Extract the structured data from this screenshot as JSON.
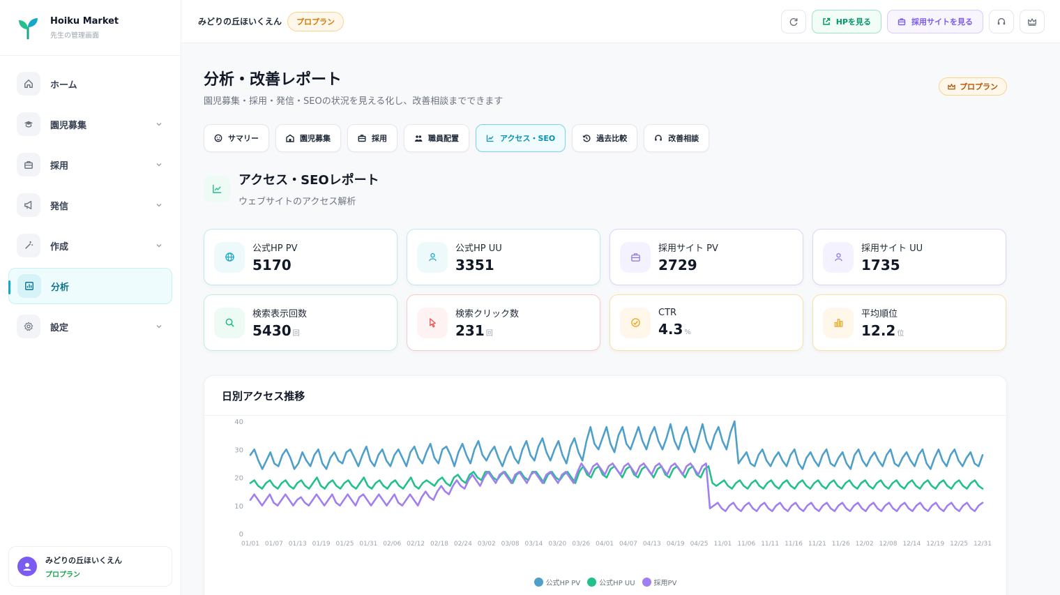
{
  "brand": {
    "name": "Hoiku Market",
    "subtitle": "先生の管理画面"
  },
  "sidebar": {
    "items": [
      {
        "label": "ホーム",
        "icon": "home-icon",
        "expandable": false
      },
      {
        "label": "園児募集",
        "icon": "graduation-cap-icon",
        "expandable": true
      },
      {
        "label": "採用",
        "icon": "briefcase-icon",
        "expandable": true
      },
      {
        "label": "発信",
        "icon": "megaphone-icon",
        "expandable": true
      },
      {
        "label": "作成",
        "icon": "wand-icon",
        "expandable": true
      },
      {
        "label": "分析",
        "icon": "chart-icon",
        "expandable": false,
        "active": true
      },
      {
        "label": "設定",
        "icon": "gear-icon",
        "expandable": true
      }
    ],
    "user": {
      "name": "みどりの丘ほいくえん",
      "plan": "プロプラン"
    }
  },
  "topbar": {
    "nursery": "みどりの丘ほいくえん",
    "plan": "プロプラン",
    "hp_button": "HPを見る",
    "recruit_button": "採用サイトを見る"
  },
  "page": {
    "title": "分析・改善レポート",
    "subtitle": "園児募集・採用・発信・SEOの状況を見える化し、改善相談までできます",
    "badge": "プロプラン"
  },
  "tabs": [
    {
      "label": "サマリー",
      "icon": "smile-icon"
    },
    {
      "label": "園児募集",
      "icon": "school-icon"
    },
    {
      "label": "採用",
      "icon": "briefcase-icon"
    },
    {
      "label": "職員配置",
      "icon": "people-icon"
    },
    {
      "label": "アクセス・SEO",
      "icon": "trend-icon",
      "active": true
    },
    {
      "label": "過去比較",
      "icon": "history-icon"
    },
    {
      "label": "改善相談",
      "icon": "headset-icon"
    }
  ],
  "section": {
    "title": "アクセス・SEOレポート",
    "subtitle": "ウェブサイトのアクセス解析"
  },
  "metrics": [
    {
      "label": "公式HP PV",
      "value": "5170",
      "unit": "",
      "icon": "globe-icon",
      "color": "#0ea5c6",
      "bg": "#eef9fc",
      "border": "#bfe9f2"
    },
    {
      "label": "公式HP UU",
      "value": "3351",
      "unit": "",
      "icon": "user-icon",
      "color": "#0ea5c6",
      "bg": "#eef9fc",
      "border": "#bfe9f2"
    },
    {
      "label": "採用サイト PV",
      "value": "2729",
      "unit": "",
      "icon": "briefcase-icon",
      "color": "#8b6cf0",
      "bg": "#f5f2ff",
      "border": "#ddd3fb"
    },
    {
      "label": "採用サイト UU",
      "value": "1735",
      "unit": "",
      "icon": "user-icon",
      "color": "#8b6cf0",
      "bg": "#f5f2ff",
      "border": "#ddd3fb"
    },
    {
      "label": "検索表示回数",
      "value": "5430",
      "unit": "回",
      "icon": "search-icon",
      "color": "#10b981",
      "bg": "#eefaf4",
      "border": "#bfeedd"
    },
    {
      "label": "検索クリック数",
      "value": "231",
      "unit": "回",
      "icon": "pointer-icon",
      "color": "#ef4444",
      "bg": "#fef2f2",
      "border": "#f9c9c9"
    },
    {
      "label": "CTR",
      "value": "4.3",
      "unit": "%",
      "icon": "target-icon",
      "color": "#f59e0b",
      "bg": "#fff8ea",
      "border": "#f9e2a6"
    },
    {
      "label": "平均順位",
      "value": "12.2",
      "unit": "位",
      "icon": "bar-icon",
      "color": "#f59e0b",
      "bg": "#fff8ea",
      "border": "#f9e2a6"
    }
  ],
  "chart_title": "日別アクセス推移",
  "chart_data": {
    "type": "line",
    "ylim": [
      0,
      40
    ],
    "yticks": [
      0,
      10,
      20,
      30,
      40
    ],
    "xticks": [
      "01/01",
      "01/07",
      "01/13",
      "01/19",
      "01/25",
      "01/31",
      "02/06",
      "02/12",
      "02/18",
      "02/24",
      "03/02",
      "03/08",
      "03/14",
      "03/20",
      "03/26",
      "04/01",
      "04/07",
      "04/13",
      "04/19",
      "04/25",
      "11/01",
      "11/06",
      "11/11",
      "11/16",
      "11/21",
      "11/26",
      "12/02",
      "12/08",
      "12/14",
      "12/19",
      "12/25",
      "12/31"
    ],
    "series": [
      {
        "name": "公式HP PV",
        "color": "#4e9fc9",
        "values": [
          28,
          30,
          26,
          23,
          26,
          29,
          25,
          24,
          28,
          30,
          27,
          23,
          25,
          29,
          26,
          24,
          28,
          30,
          25,
          23,
          27,
          29,
          26,
          25,
          29,
          30,
          27,
          24,
          28,
          31,
          26,
          24,
          28,
          30,
          26,
          24,
          28,
          30,
          27,
          24,
          29,
          31,
          27,
          25,
          29,
          32,
          27,
          25,
          30,
          31,
          28,
          24,
          29,
          32,
          28,
          25,
          30,
          33,
          28,
          26,
          29,
          31,
          27,
          24,
          28,
          31,
          27,
          25,
          30,
          33,
          28,
          26,
          31,
          34,
          29,
          26,
          30,
          33,
          28,
          25,
          31,
          34,
          29,
          26,
          33,
          38,
          32,
          30,
          34,
          38,
          32,
          29,
          35,
          38,
          32,
          30,
          34,
          38,
          33,
          30,
          35,
          38,
          33,
          30,
          34,
          39,
          33,
          30,
          35,
          38,
          32,
          29,
          34,
          39,
          33,
          30,
          35,
          38,
          33,
          30,
          36,
          40,
          25,
          27,
          29,
          25,
          24,
          28,
          30,
          26,
          24,
          27,
          29,
          26,
          24,
          28,
          30,
          25,
          23,
          27,
          29,
          26,
          24,
          28,
          30,
          25,
          24,
          27,
          29,
          25,
          23,
          28,
          30,
          26,
          24,
          27,
          29,
          26,
          24,
          28,
          30,
          25,
          24,
          27,
          29,
          26,
          24,
          28,
          30,
          25,
          23,
          27,
          30,
          26,
          24,
          28,
          30,
          26,
          24,
          27,
          29,
          25,
          24,
          28
        ]
      },
      {
        "name": "公式HP UU",
        "color": "#22c08a",
        "values": [
          18,
          19,
          17,
          16,
          18,
          19,
          17,
          16,
          18,
          19,
          17,
          16,
          18,
          19,
          17,
          16,
          18,
          20,
          17,
          16,
          18,
          19,
          17,
          16,
          18,
          19,
          17,
          16,
          18,
          20,
          17,
          16,
          18,
          19,
          17,
          16,
          18,
          19,
          17,
          16,
          18,
          20,
          17,
          16,
          18,
          19,
          18,
          17,
          19,
          20,
          18,
          17,
          20,
          21,
          19,
          18,
          21,
          22,
          20,
          19,
          22,
          22,
          20,
          19,
          21,
          22,
          20,
          18,
          21,
          22,
          20,
          19,
          22,
          22,
          20,
          18,
          21,
          22,
          20,
          19,
          21,
          22,
          20,
          18,
          22,
          24,
          21,
          20,
          23,
          24,
          21,
          20,
          23,
          24,
          22,
          20,
          23,
          24,
          21,
          20,
          23,
          24,
          22,
          20,
          23,
          24,
          21,
          20,
          23,
          24,
          22,
          20,
          23,
          24,
          21,
          20,
          23,
          24,
          18,
          17,
          18,
          19,
          17,
          16,
          18,
          19,
          17,
          16,
          18,
          19,
          17,
          16,
          18,
          19,
          17,
          16,
          18,
          19,
          17,
          16,
          18,
          19,
          17,
          16,
          18,
          19,
          17,
          16,
          18,
          19,
          17,
          16,
          18,
          19,
          17,
          16,
          18,
          19,
          17,
          16,
          18,
          19,
          17,
          16,
          18,
          19,
          17,
          16,
          18,
          19,
          17,
          16,
          18,
          19,
          17,
          16,
          18,
          19,
          17,
          16,
          18,
          19,
          17,
          16,
          18,
          19,
          17,
          16
        ]
      },
      {
        "name": "採用PV",
        "color": "#a07ff0",
        "values": [
          12,
          14,
          12,
          10,
          12,
          14,
          11,
          10,
          12,
          14,
          12,
          10,
          12,
          13,
          11,
          10,
          12,
          14,
          12,
          10,
          12,
          14,
          11,
          10,
          12,
          14,
          12,
          10,
          13,
          14,
          12,
          10,
          12,
          14,
          12,
          10,
          12,
          14,
          11,
          10,
          12,
          14,
          12,
          10,
          13,
          15,
          13,
          12,
          15,
          17,
          15,
          14,
          17,
          19,
          17,
          16,
          19,
          21,
          19,
          17,
          20,
          22,
          20,
          18,
          21,
          22,
          20,
          18,
          21,
          22,
          20,
          18,
          21,
          22,
          20,
          18,
          21,
          22,
          20,
          18,
          21,
          22,
          20,
          18,
          22,
          25,
          23,
          21,
          24,
          25,
          23,
          21,
          24,
          25,
          23,
          21,
          24,
          25,
          23,
          21,
          24,
          25,
          23,
          21,
          24,
          25,
          23,
          21,
          24,
          25,
          23,
          21,
          24,
          25,
          23,
          21,
          24,
          25,
          9,
          10,
          11,
          9,
          8,
          10,
          11,
          9,
          8,
          10,
          11,
          9,
          8,
          10,
          11,
          9,
          8,
          10,
          11,
          9,
          8,
          10,
          11,
          9,
          8,
          10,
          11,
          9,
          8,
          10,
          11,
          9,
          8,
          10,
          11,
          9,
          8,
          10,
          11,
          9,
          8,
          10,
          11,
          9,
          8,
          10,
          11,
          9,
          8,
          10,
          11,
          9,
          8,
          10,
          11,
          9,
          8,
          10,
          11,
          9,
          8,
          10,
          11,
          9,
          8,
          10,
          11,
          9,
          8,
          10,
          11
        ]
      }
    ]
  }
}
